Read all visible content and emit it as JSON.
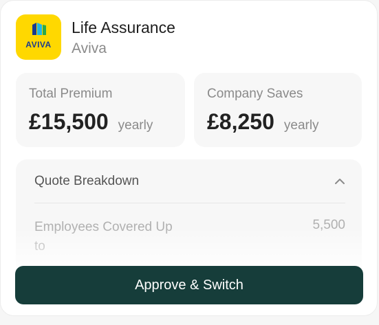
{
  "header": {
    "logo_text": "AVIVA",
    "title": "Life Assurance",
    "provider": "Aviva"
  },
  "stats": [
    {
      "label": "Total Premium",
      "value": "£15,500",
      "unit": "yearly"
    },
    {
      "label": "Company Saves",
      "value": "£8,250",
      "unit": "yearly"
    }
  ],
  "breakdown": {
    "title": "Quote Breakdown",
    "rows": [
      {
        "label": "Employees Covered Up to",
        "value": "5,500"
      }
    ]
  },
  "cta": {
    "label": "Approve & Switch"
  },
  "colors": {
    "brand_yellow": "#ffd800",
    "brand_blue": "#1a3b8f",
    "button_bg": "#163d3a"
  }
}
